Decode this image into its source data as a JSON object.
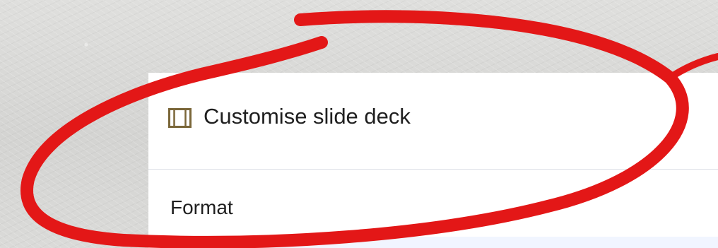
{
  "dialog": {
    "title": "Customise slide deck",
    "icon": "slide-deck-icon",
    "section_label": "Format"
  },
  "colors": {
    "annotation": "#e31717",
    "icon": "#7a6638",
    "text": "#1f1f1f",
    "divider": "#dde0e7",
    "format_strip": "#f1f5ff"
  }
}
